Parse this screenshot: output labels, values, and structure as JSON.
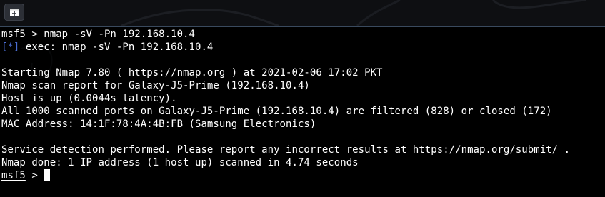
{
  "titlebar": {
    "new_tab_icon": "new-tab-icon"
  },
  "terminal": {
    "prompt": "msf5",
    "prompt_symbol": " > ",
    "command": "nmap -sV -Pn 192.168.10.4",
    "info_tag": "[*]",
    "exec_line": " exec: nmap -sV -Pn 192.168.10.4",
    "output": [
      "",
      "Starting Nmap 7.80 ( https://nmap.org ) at 2021-02-06 17:02 PKT",
      "Nmap scan report for Galaxy-J5-Prime (192.168.10.4)",
      "Host is up (0.0044s latency).",
      "All 1000 scanned ports on Galaxy-J5-Prime (192.168.10.4) are filtered (828) or closed (172)",
      "MAC Address: 14:1F:78:4A:4B:FB (Samsung Electronics)",
      "",
      "Service detection performed. Please report any incorrect results at https://nmap.org/submit/ .",
      "Nmap done: 1 IP address (1 host up) scanned in 4.74 seconds"
    ],
    "final_prompt": "msf5",
    "final_prompt_symbol": " > "
  },
  "colors": {
    "background": "#000000",
    "text": "#ffffff",
    "info_tag": "#4a6cd0",
    "titlebar": "#0e0f12"
  }
}
